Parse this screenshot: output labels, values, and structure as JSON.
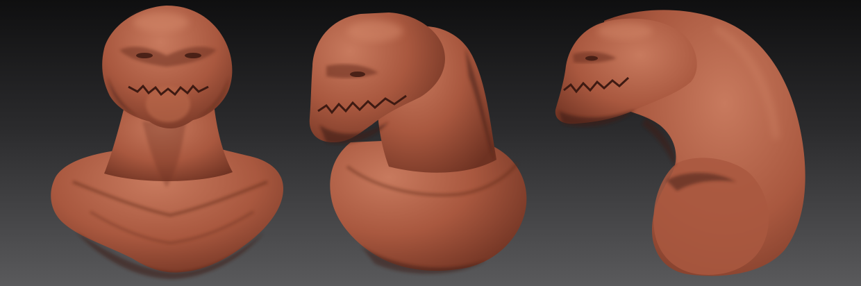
{
  "scene": {
    "background_top": "#0f0f10",
    "background_bottom": "#5a5a5c",
    "clay_light": "#c87a5e",
    "clay_mid": "#a9583f",
    "clay_dark": "#6e3222",
    "clay_shadow": "#3e1a12"
  },
  "views": [
    {
      "name": "front-view"
    },
    {
      "name": "three-quarter-view"
    },
    {
      "name": "side-view"
    }
  ]
}
